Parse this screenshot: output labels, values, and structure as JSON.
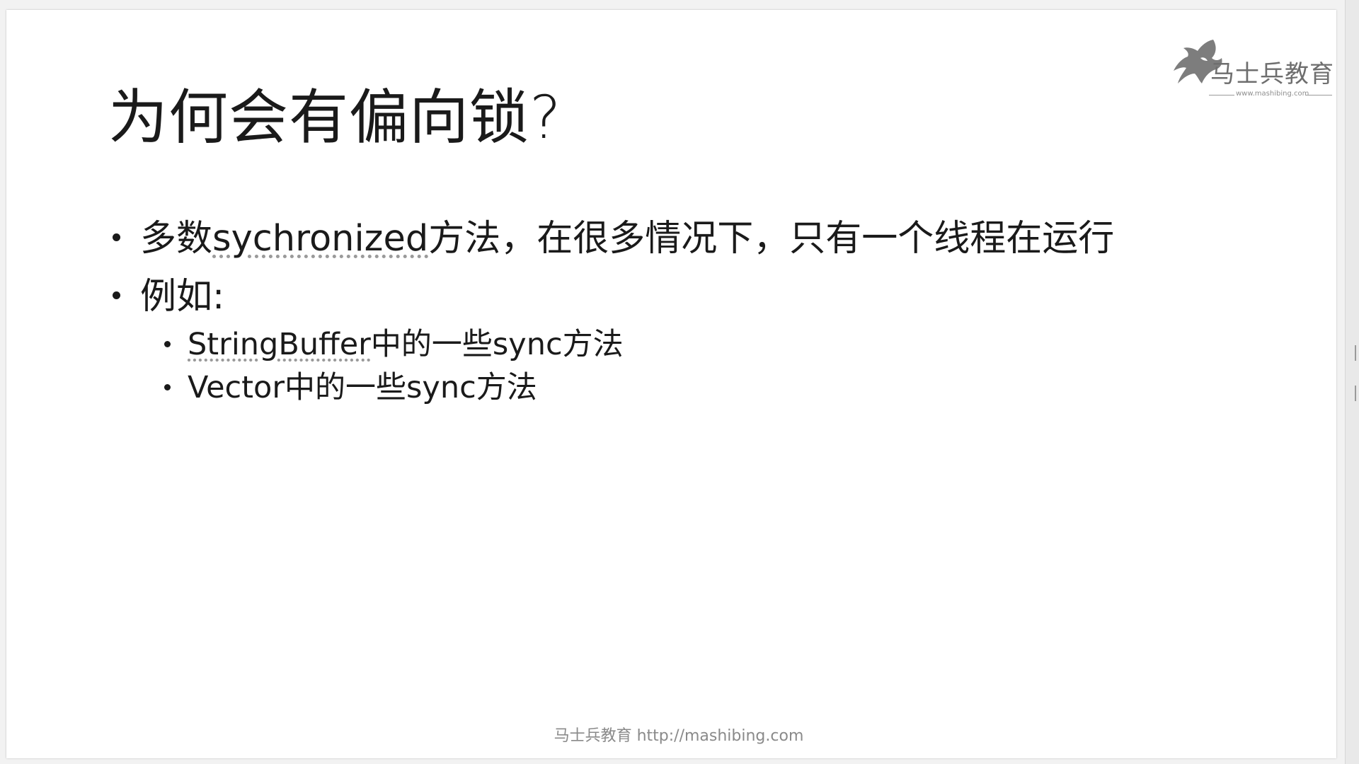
{
  "slide": {
    "title": "为何会有偏向锁?",
    "bullets": [
      {
        "prefix": "多数",
        "term": "sychronized",
        "suffix": "方法，在很多情况下，只有一个线程在运行"
      },
      {
        "text": "例如:",
        "sub_bullets": [
          {
            "term": "StringBuffer",
            "suffix": "中的一些sync方法"
          },
          {
            "text": "Vector中的一些sync方法"
          }
        ]
      }
    ],
    "footer": "马士兵教育 http://mashibing.com"
  },
  "logo": {
    "name": "马士兵教育",
    "url": "www.mashibing.com",
    "icon": "horse-head-icon"
  }
}
